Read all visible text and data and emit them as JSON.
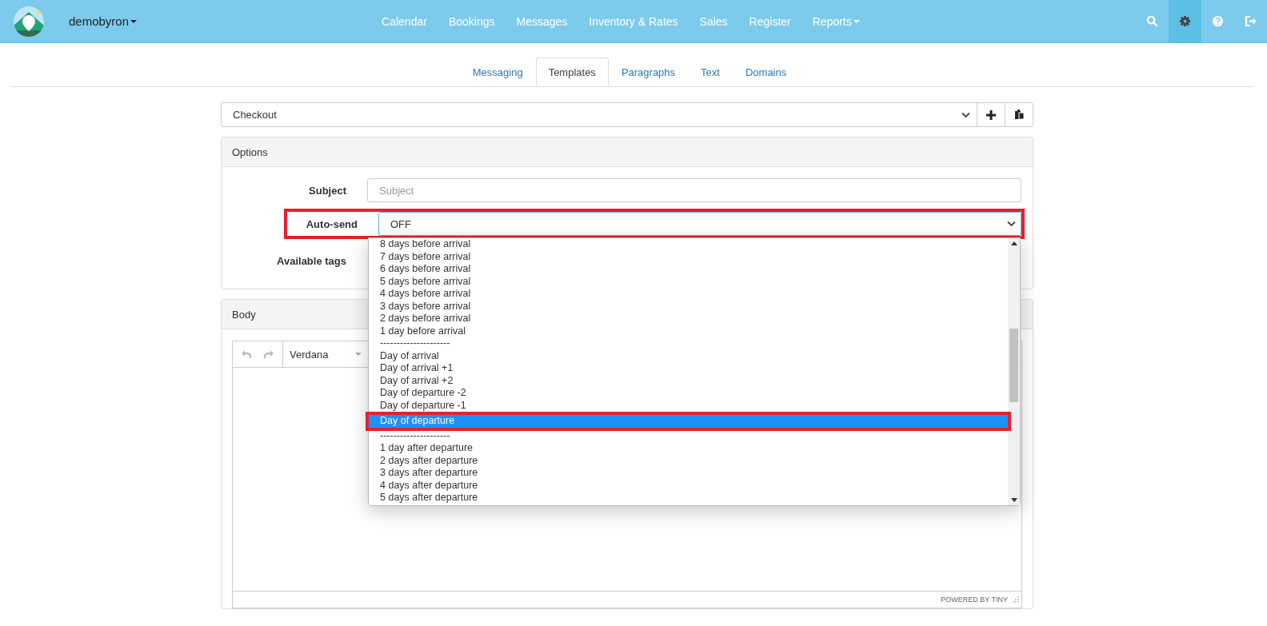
{
  "navbar": {
    "brand": "demobyron",
    "menu": [
      {
        "label": "Calendar",
        "dropdown": false
      },
      {
        "label": "Bookings",
        "dropdown": false
      },
      {
        "label": "Messages",
        "dropdown": false
      },
      {
        "label": "Inventory & Rates",
        "dropdown": false
      },
      {
        "label": "Sales",
        "dropdown": false
      },
      {
        "label": "Register",
        "dropdown": false
      },
      {
        "label": "Reports",
        "dropdown": true
      }
    ],
    "icons": [
      {
        "kind": "search",
        "selected": false
      },
      {
        "kind": "settings",
        "selected": true
      },
      {
        "kind": "help",
        "selected": false
      },
      {
        "kind": "logout",
        "selected": false
      }
    ]
  },
  "tabs": [
    {
      "label": "Messaging",
      "selected": false
    },
    {
      "label": "Templates",
      "selected": true
    },
    {
      "label": "Paragraphs",
      "selected": false
    },
    {
      "label": "Text",
      "selected": false
    },
    {
      "label": "Domains",
      "selected": false
    }
  ],
  "template_select": {
    "value": "Checkout"
  },
  "options": {
    "title": "Options",
    "subject": {
      "label": "Subject",
      "placeholder": "Subject"
    },
    "auto_send": {
      "label": "Auto-send",
      "value": "OFF",
      "highlighted": true
    },
    "available_tags": {
      "label": "Available tags"
    }
  },
  "dropdown": {
    "options": [
      {
        "label": "8 days before arrival",
        "selected": false
      },
      {
        "label": "7 days before arrival",
        "selected": false
      },
      {
        "label": "6 days before arrival",
        "selected": false
      },
      {
        "label": "5 days before arrival",
        "selected": false
      },
      {
        "label": "4 days before arrival",
        "selected": false
      },
      {
        "label": "3 days before arrival",
        "selected": false
      },
      {
        "label": "2 days before arrival",
        "selected": false
      },
      {
        "label": "1 day before arrival",
        "selected": false
      },
      {
        "label": "---------------------",
        "selected": false
      },
      {
        "label": "Day of arrival",
        "selected": false
      },
      {
        "label": "Day of arrival +1",
        "selected": false
      },
      {
        "label": "Day of arrival +2",
        "selected": false
      },
      {
        "label": "Day of departure -2",
        "selected": false
      },
      {
        "label": "Day of departure -1",
        "selected": false
      },
      {
        "label": "Day of departure",
        "selected": true
      },
      {
        "label": "---------------------",
        "selected": false
      },
      {
        "label": "1 day after departure",
        "selected": false
      },
      {
        "label": "2 days after departure",
        "selected": false
      },
      {
        "label": "3 days after departure",
        "selected": false
      },
      {
        "label": "4 days after departure",
        "selected": false
      },
      {
        "label": "5 days after departure",
        "selected": false
      }
    ]
  },
  "body": {
    "title": "Body",
    "font": "Verdana",
    "footer": "POWERED BY TINY"
  }
}
